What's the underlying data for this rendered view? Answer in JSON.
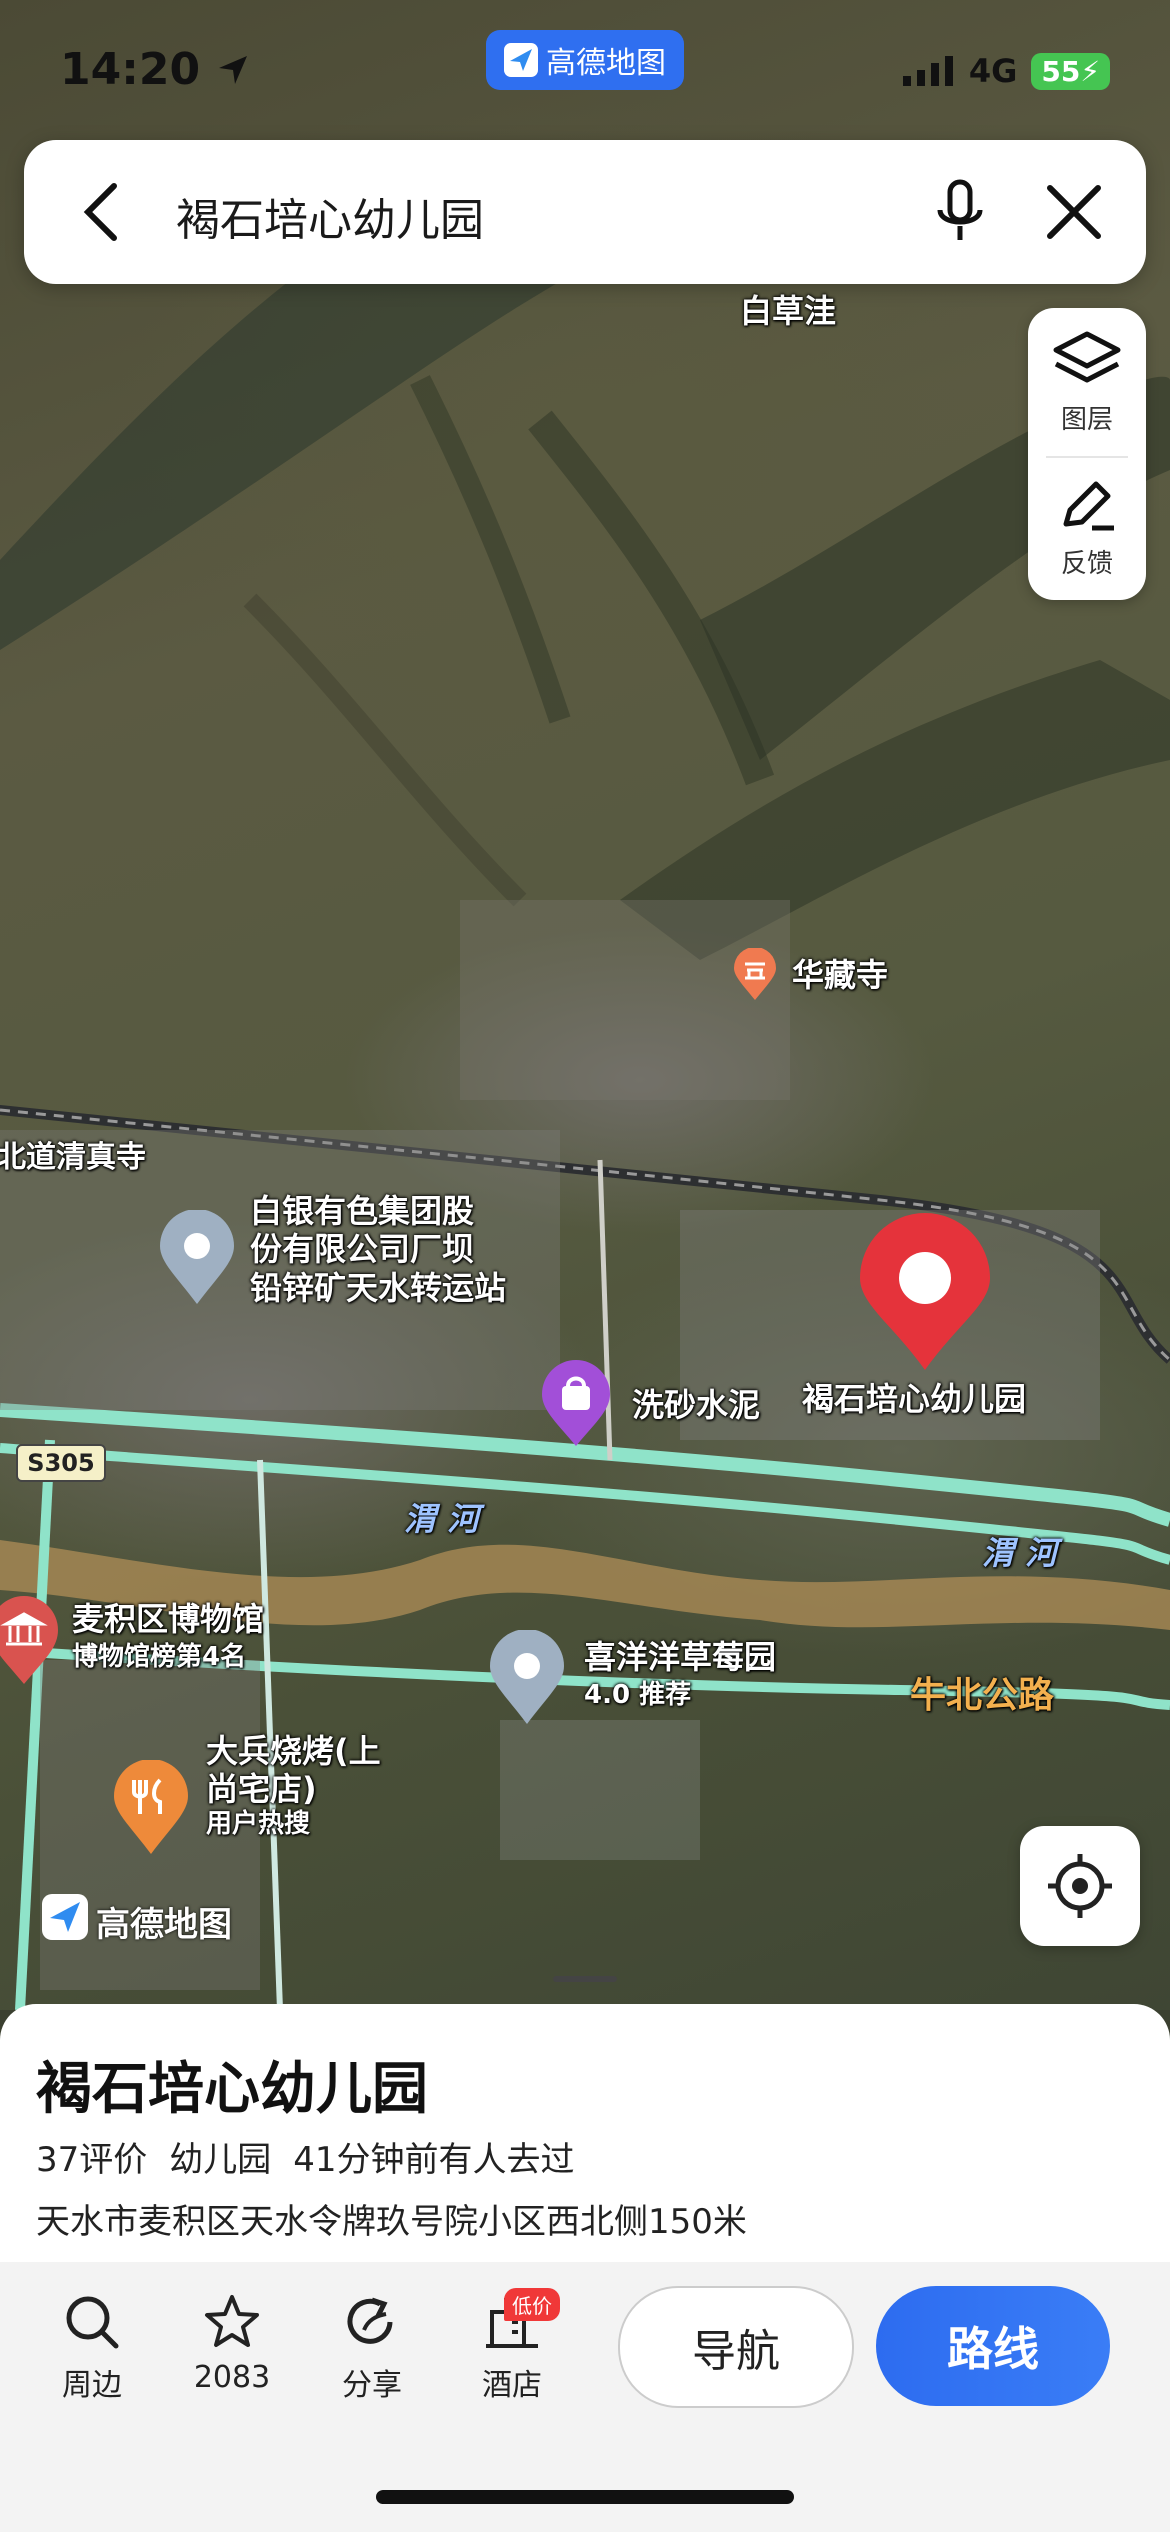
{
  "status_bar": {
    "time": "14:20",
    "app_pill": "高德地图",
    "network": "4G",
    "battery": "55"
  },
  "search": {
    "query": "褐石培心幼儿园"
  },
  "side_tools": [
    {
      "label": "图层"
    },
    {
      "label": "反馈"
    }
  ],
  "map_labels": {
    "baicaowa": "白草洼",
    "huazangsi": "华藏寺",
    "mosque": "北道清真寺",
    "baiyin": [
      "白银有色集团股",
      "份有限公司厂坝",
      "铅锌矿天水转运站"
    ],
    "xisha": "洗砂水泥",
    "kindergarten": "褐石培心幼儿园",
    "s305": "S305",
    "weihe_1": "渭 河",
    "weihe_2": "渭 河",
    "museum": "麦积区博物馆",
    "museum_sub": "博物馆榜第4名",
    "xiyangyang": "喜洋洋草莓园",
    "xiyangyang_sub": "4.0 推荐",
    "niubei": "牛北公路",
    "dabing": [
      "大兵烧烤(上",
      "尚宅店)"
    ],
    "dabing_sub": "用户热搜",
    "watermark": "高德地图"
  },
  "poi": {
    "title": "褐石培心幼儿园",
    "reviews": "37评价",
    "category": "幼儿园",
    "recent": "41分钟前有人去过",
    "address": "天水市麦积区天水令牌玖号院小区西北侧150米"
  },
  "toolbar": {
    "nearby": "周边",
    "favorites": "2083",
    "share": "分享",
    "hotel": "酒店",
    "hotel_badge": "低价",
    "navigate": "导航",
    "route": "路线"
  },
  "colors": {
    "accent": "#2f6ff0",
    "pin": "#e5333b",
    "road": "#7fd6c0"
  }
}
